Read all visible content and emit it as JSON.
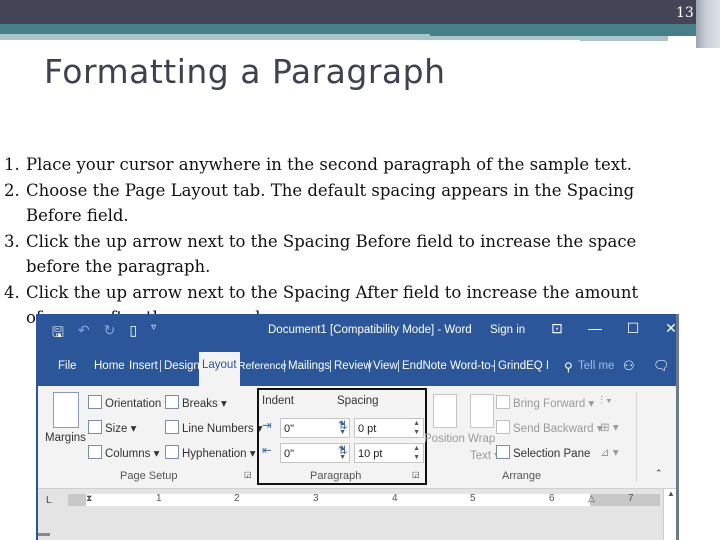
{
  "slide": {
    "number": "13",
    "title": "Formatting a Paragraph",
    "steps": [
      {
        "num": "1.",
        "text": "Place your cursor anywhere in the second paragraph of the sample text."
      },
      {
        "num": "2.",
        "text": "Choose the Page Layout tab. The default spacing appears in the Spacing",
        "cont": "Before field."
      },
      {
        "num": "3.",
        "text": "Click the up arrow next to the Spacing Before field to increase the space",
        "cont": "before the paragraph."
      },
      {
        "num": "4.",
        "text": "Click the up arrow next to the Spacing After field to increase the amount",
        "cont": "of space after the paragraph."
      }
    ]
  },
  "word": {
    "title": "Document1 [Compatibility Mode] - Word",
    "sign_in": "Sign in",
    "qat_icons": [
      "save-icon",
      "undo-icon",
      "redo-icon",
      "new-document-icon",
      "customize-qat-icon"
    ],
    "window_controls": {
      "ribbon_options": "⊡",
      "minimize": "—",
      "maximize": "☐",
      "close": "✕"
    },
    "tabs": [
      "File",
      "Home",
      "Insert",
      "Design",
      "Layout",
      "Reference",
      "Mailings",
      "Review",
      "View",
      "EndNote",
      "Word-to-",
      "GrindEQ I",
      "Tell me"
    ],
    "active_tab": "Layout",
    "share_icon": "person-icon",
    "comments_icon": "comment-icon",
    "page_setup": {
      "label": "Page Setup",
      "margins": "Margins",
      "orientation": "Orientation ▾",
      "size": "Size ▾",
      "columns": "Columns ▾",
      "breaks": "Breaks ▾",
      "line_numbers": "Line Numbers ▾",
      "hyphenation": "Hyphenation ▾"
    },
    "paragraph": {
      "label": "Paragraph",
      "indent_label": "Indent",
      "spacing_label": "Spacing",
      "indent_left": "0\"",
      "indent_right": "0\"",
      "spacing_before": "0 pt",
      "spacing_after": "10 pt"
    },
    "arrange": {
      "label": "Arrange",
      "position": "Position",
      "wrap_text": "Wrap",
      "wrap_text2": "Text ▾",
      "bring_forward": "Bring Forward ▾",
      "send_backward": "Send Backward ▾",
      "selection_pane": "Selection Pane"
    },
    "ruler": {
      "tab_selector": "L",
      "numbers": [
        "1",
        "2",
        "3",
        "4",
        "5",
        "6",
        "7"
      ]
    }
  }
}
